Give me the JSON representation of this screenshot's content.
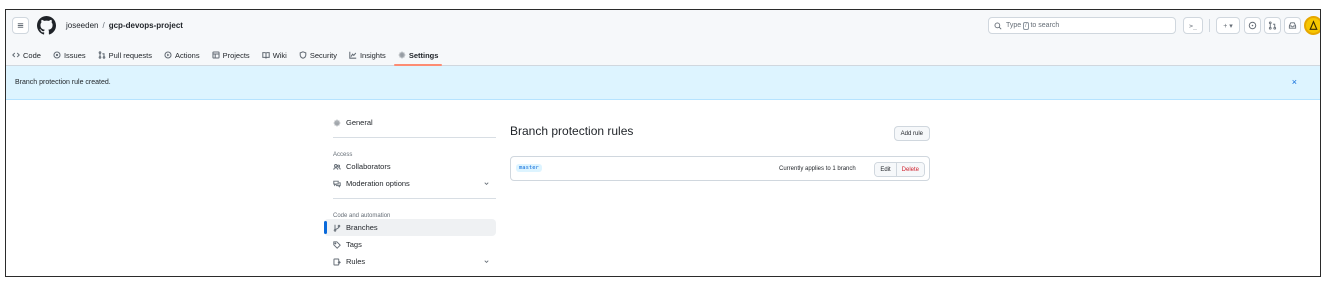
{
  "header": {
    "owner": "joseeden",
    "separator": "/",
    "repo": "gcp-devops-project",
    "search_placeholder": "Type",
    "search_key": "/",
    "search_suffix": "to search",
    "command_glyph": ">_",
    "plus_glyph": "+ ▾"
  },
  "tabs": [
    {
      "label": "Code",
      "icon": "code-icon"
    },
    {
      "label": "Issues",
      "icon": "issue-opened-icon"
    },
    {
      "label": "Pull requests",
      "icon": "git-pull-request-icon"
    },
    {
      "label": "Actions",
      "icon": "play-icon"
    },
    {
      "label": "Projects",
      "icon": "table-icon"
    },
    {
      "label": "Wiki",
      "icon": "book-icon"
    },
    {
      "label": "Security",
      "icon": "shield-icon"
    },
    {
      "label": "Insights",
      "icon": "graph-icon"
    },
    {
      "label": "Settings",
      "icon": "gear-icon",
      "selected": true
    }
  ],
  "flash": {
    "message": "Branch protection rule created.",
    "close": "×"
  },
  "sidebar": {
    "general": "General",
    "access_heading": "Access",
    "collaborators": "Collaborators",
    "moderation": "Moderation options",
    "code_heading": "Code and automation",
    "branches": "Branches",
    "tags": "Tags",
    "rules": "Rules"
  },
  "main": {
    "title": "Branch protection rules",
    "add_rule": "Add rule",
    "rules": [
      {
        "branch": "master",
        "applies": "Currently applies to 1 branch",
        "edit": "Edit",
        "delete": "Delete"
      }
    ]
  },
  "colors": {
    "accent": "#0969da",
    "flash_bg": "#ddf4ff",
    "tab_underline": "#fd8c73",
    "danger": "#cf222e",
    "avatar": "#f7c600"
  }
}
